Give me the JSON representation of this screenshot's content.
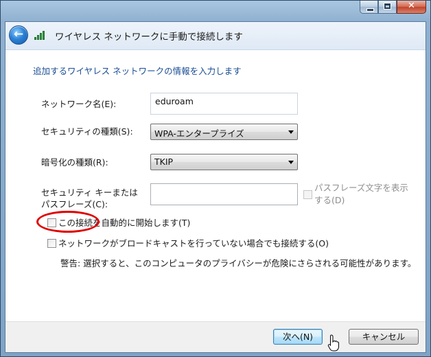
{
  "window": {
    "minimize_glyph": "",
    "maximize_glyph": "",
    "close_glyph": "✕"
  },
  "header": {
    "back_icon": "back-arrow-icon",
    "signal_icon": "wireless-signal-icon",
    "title": "ワイヤレス ネットワークに手動で接続します"
  },
  "main": {
    "instruction": "追加するワイヤレス ネットワークの情報を入力します",
    "network_name": {
      "label": "ネットワーク名(E):",
      "value": "eduroam"
    },
    "security_type": {
      "label": "セキュリティの種類(S):",
      "selected": "WPA-エンタープライズ"
    },
    "encryption_type": {
      "label": "暗号化の種類(R):",
      "selected": "TKIP"
    },
    "security_key": {
      "label_line1": "セキュリティ キーまたは",
      "label_line2": "パスフレーズ(C):",
      "value": "",
      "show_chars_line1": "パスフレーズ文字を表示",
      "show_chars_line2": "する(D)",
      "show_chars_checked": false,
      "show_chars_enabled": false
    },
    "auto_connect": {
      "label": "この接続を自動的に開始します(T)",
      "checked": false
    },
    "connect_hidden": {
      "label": "ネットワークがブロードキャストを行っていない場合でも接続する(O)",
      "checked": false
    },
    "warning": "警告: 選択すると、このコンピュータのプライバシーが危険にさらされる可能性があります。"
  },
  "footer": {
    "next_label": "次へ(N)",
    "cancel_label": "キャンセル"
  },
  "colors": {
    "instruction_text": "#1a4d94",
    "highlight_annotation": "#e00000",
    "window_frame": "#7ea3c6"
  }
}
